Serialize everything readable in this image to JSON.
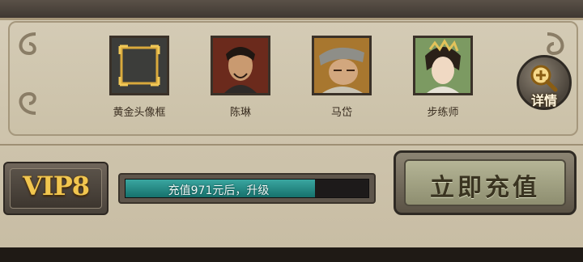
{
  "rewards": [
    {
      "label": "黄金头像框"
    },
    {
      "label": "陈琳"
    },
    {
      "label": "马岱"
    },
    {
      "label": "步练师"
    }
  ],
  "detail_button": {
    "label": "详情",
    "icon": "magnifier-icon"
  },
  "vip": {
    "text": "VIP8"
  },
  "progress": {
    "text": "充值971元后，升级",
    "fraction": 0.78,
    "fill_color": "#2a8f89"
  },
  "recharge_button": {
    "label": "立即充值"
  }
}
